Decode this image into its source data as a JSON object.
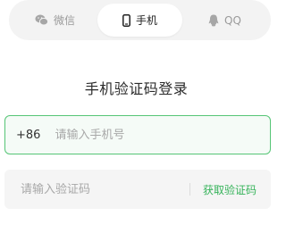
{
  "tabs": [
    {
      "label": "微信",
      "icon": "wechat-icon",
      "active": false
    },
    {
      "label": "手机",
      "icon": "phone-icon",
      "active": true
    },
    {
      "label": "QQ",
      "icon": "qq-icon",
      "active": false
    }
  ],
  "title": "手机验证码登录",
  "phone": {
    "country_code": "+86",
    "placeholder": "请输入手机号",
    "value": ""
  },
  "code": {
    "placeholder": "请输入验证码",
    "value": "",
    "get_code_label": "获取验证码"
  },
  "colors": {
    "accent": "#36b35a",
    "focus_border": "#56c576",
    "tab_bg": "#f3f3f3",
    "field_bg": "#f5f5f5"
  }
}
